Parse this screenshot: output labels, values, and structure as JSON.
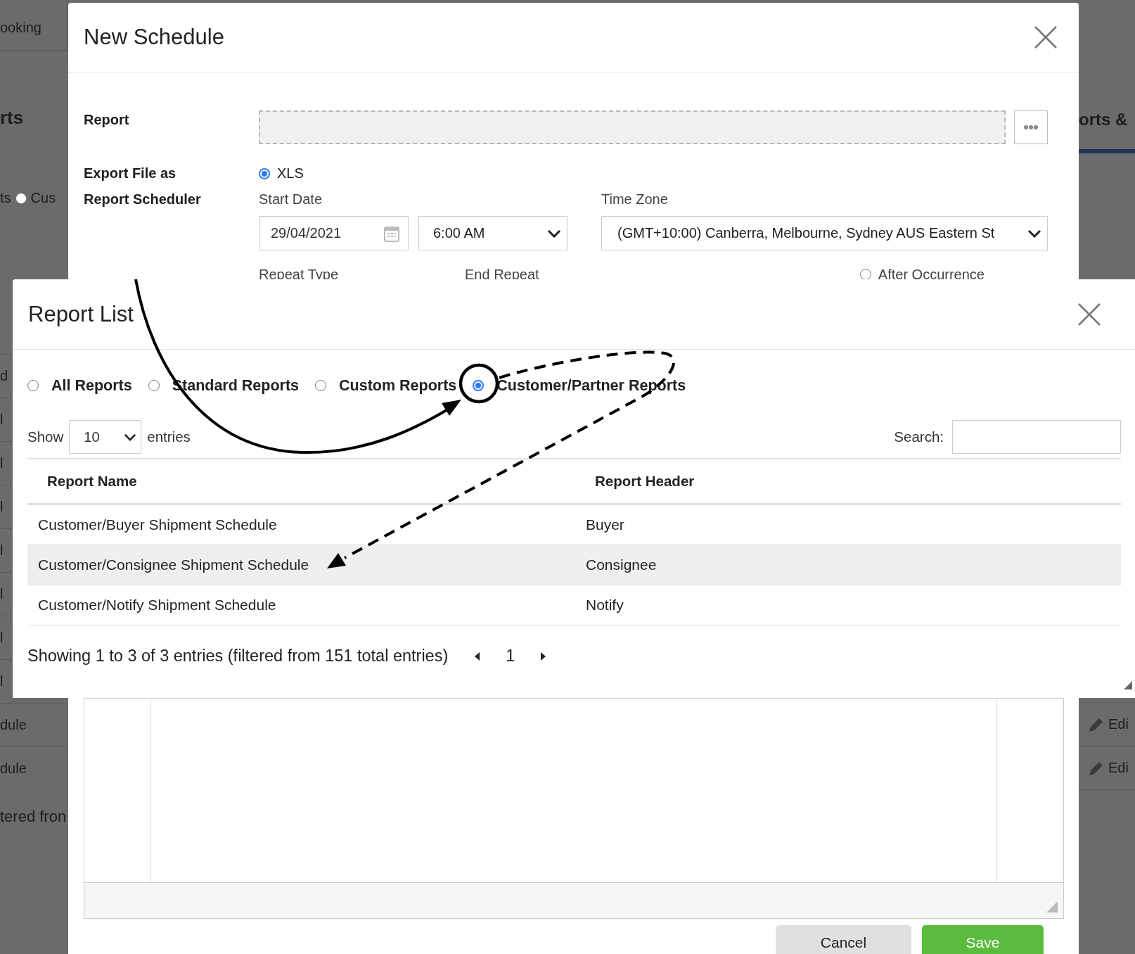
{
  "background_page": {
    "tab_label": "ooking",
    "heading": "rts",
    "filter_text": "ts",
    "filter_radio": {
      "label": "Cus",
      "selected": false
    },
    "row_fragments": [
      "d",
      "l",
      "l",
      "l",
      "l",
      "l",
      "l",
      "l",
      "dule",
      "dule"
    ],
    "footer_fragment": "tered fron",
    "right_heading": "orts &",
    "edit_links": [
      "Edi",
      "Edi"
    ]
  },
  "new_schedule": {
    "title": "New Schedule",
    "report_label": "Report",
    "export": {
      "label": "Export File as",
      "options": [
        {
          "label": "XLS",
          "selected": true
        }
      ]
    },
    "scheduler": {
      "label": "Report Scheduler",
      "start_date": {
        "label": "Start Date",
        "value": "29/04/2021"
      },
      "time": {
        "value": "6:00 AM"
      },
      "time_zone": {
        "label": "Time Zone",
        "value": "(GMT+10:00) Canberra, Melbourne, Sydney AUS Eastern St"
      },
      "repeat_type_label": "Repeat Type",
      "end_repeat_label": "End Repeat",
      "after_occurrence": {
        "label": "After Occurrence",
        "selected": false
      }
    },
    "buttons": [
      {
        "label": "Cancel",
        "kind": "secondary"
      },
      {
        "label": "Save",
        "kind": "primary"
      }
    ]
  },
  "report_list": {
    "title": "Report List",
    "filters": [
      {
        "label": "All Reports",
        "selected": false
      },
      {
        "label": "Standard Reports",
        "selected": false
      },
      {
        "label": "Custom Reports",
        "selected": false
      },
      {
        "label": "Customer/Partner Reports",
        "selected": true
      }
    ],
    "show_label": "Show",
    "page_length": "10",
    "entries_label": "entries",
    "search_label": "Search:",
    "columns": [
      "Report Name",
      "Report Header"
    ],
    "rows": [
      {
        "cells": [
          "Customer/Buyer Shipment Schedule",
          "Buyer"
        ],
        "selected": false
      },
      {
        "cells": [
          "Customer/Consignee Shipment Schedule",
          "Consignee"
        ],
        "selected": true
      },
      {
        "cells": [
          "Customer/Notify Shipment Schedule",
          "Notify"
        ],
        "selected": false
      }
    ],
    "info": "Showing 1 to 3 of 3 entries (filtered from 151 total entries)",
    "current_page": "1"
  }
}
